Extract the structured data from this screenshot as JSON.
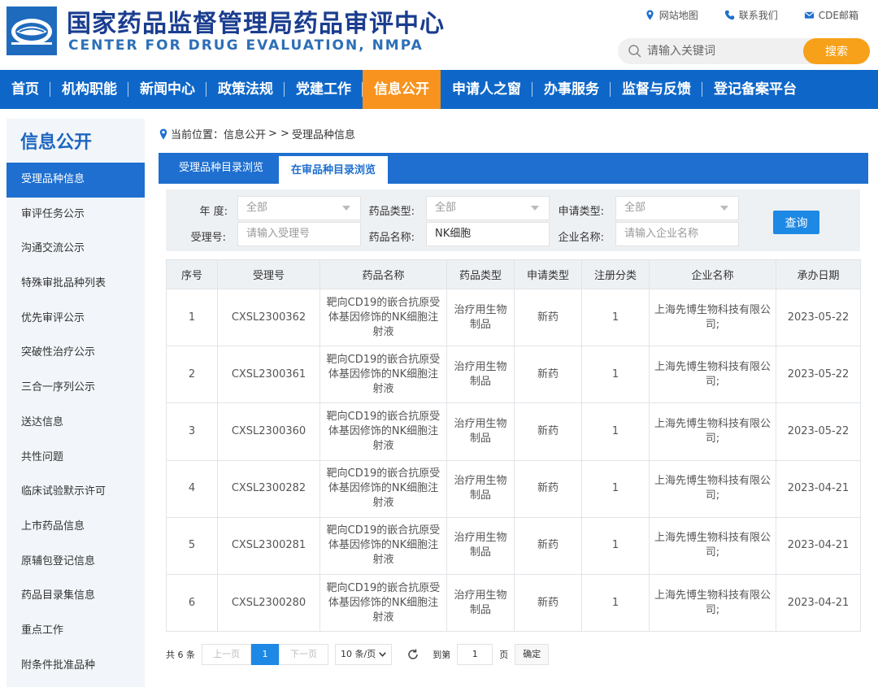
{
  "header": {
    "title_cn": "国家药品监督管理局药品审评中心",
    "title_en": "CENTER FOR DRUG EVALUATION, NMPA",
    "links": [
      {
        "label": "网站地图",
        "icon": "location-icon"
      },
      {
        "label": "联系我们",
        "icon": "phone-icon"
      },
      {
        "label": "CDE邮箱",
        "icon": "mail-icon"
      }
    ],
    "search_placeholder": "请输入关键词",
    "search_button": "搜索"
  },
  "nav": {
    "items": [
      "首页",
      "机构职能",
      "新闻中心",
      "政策法规",
      "党建工作",
      "信息公开",
      "申请人之窗",
      "办事服务",
      "监督与反馈",
      "登记备案平台"
    ],
    "active": "信息公开"
  },
  "sidebar": {
    "title": "信息公开",
    "items": [
      "受理品种信息",
      "审评任务公示",
      "沟通交流公示",
      "特殊审批品种列表",
      "优先审评公示",
      "突破性治疗公示",
      "三合一序列公示",
      "送达信息",
      "共性问题",
      "临床试验默示许可",
      "上市药品信息",
      "原辅包登记信息",
      "药品目录集信息",
      "重点工作",
      "附条件批准品种"
    ],
    "active": "受理品种信息"
  },
  "breadcrumb": {
    "prefix": "当前位置：信息公开",
    "separator": "> >",
    "current": "受理品种信息"
  },
  "tabs": {
    "items": [
      "受理品种目录浏览",
      "在审品种目录浏览"
    ],
    "active": "在审品种目录浏览"
  },
  "filters": {
    "year_label": "年    度:",
    "year_value": "全部",
    "drug_type_label": "药品类型:",
    "drug_type_value": "全部",
    "apply_type_label": "申请类型:",
    "apply_type_value": "全部",
    "accept_no_label": "受理号:",
    "accept_no_placeholder": "请输入受理号",
    "drug_name_label": "药品名称:",
    "drug_name_value": "NK细胞",
    "company_label": "企业名称:",
    "company_placeholder": "请输入企业名称",
    "query_button": "查询"
  },
  "table": {
    "columns": [
      "序号",
      "受理号",
      "药品名称",
      "药品类型",
      "申请类型",
      "注册分类",
      "企业名称",
      "承办日期"
    ],
    "rows": [
      {
        "no": "1",
        "accept_no": "CXSL2300362",
        "drug_name": "靶向CD19的嵌合抗原受体基因修饰的NK细胞注射液",
        "drug_type": "治疗用生物制品",
        "apply_type": "新药",
        "reg_class": "1",
        "company": "上海先博生物科技有限公司;",
        "date": "2023-05-22"
      },
      {
        "no": "2",
        "accept_no": "CXSL2300361",
        "drug_name": "靶向CD19的嵌合抗原受体基因修饰的NK细胞注射液",
        "drug_type": "治疗用生物制品",
        "apply_type": "新药",
        "reg_class": "1",
        "company": "上海先博生物科技有限公司;",
        "date": "2023-05-22"
      },
      {
        "no": "3",
        "accept_no": "CXSL2300360",
        "drug_name": "靶向CD19的嵌合抗原受体基因修饰的NK细胞注射液",
        "drug_type": "治疗用生物制品",
        "apply_type": "新药",
        "reg_class": "1",
        "company": "上海先博生物科技有限公司;",
        "date": "2023-05-22"
      },
      {
        "no": "4",
        "accept_no": "CXSL2300282",
        "drug_name": "靶向CD19的嵌合抗原受体基因修饰的NK细胞注射液",
        "drug_type": "治疗用生物制品",
        "apply_type": "新药",
        "reg_class": "1",
        "company": "上海先博生物科技有限公司;",
        "date": "2023-04-21"
      },
      {
        "no": "5",
        "accept_no": "CXSL2300281",
        "drug_name": "靶向CD19的嵌合抗原受体基因修饰的NK细胞注射液",
        "drug_type": "治疗用生物制品",
        "apply_type": "新药",
        "reg_class": "1",
        "company": "上海先博生物科技有限公司;",
        "date": "2023-04-21"
      },
      {
        "no": "6",
        "accept_no": "CXSL2300280",
        "drug_name": "靶向CD19的嵌合抗原受体基因修饰的NK细胞注射液",
        "drug_type": "治疗用生物制品",
        "apply_type": "新药",
        "reg_class": "1",
        "company": "上海先博生物科技有限公司;",
        "date": "2023-04-21"
      }
    ]
  },
  "pager": {
    "total": "共 6 条",
    "prev": "上一页",
    "current_page": "1",
    "next": "下一页",
    "page_size": "10 条/页",
    "goto_label": "到第",
    "goto_value": "1",
    "page_unit": "页",
    "confirm": "确定"
  },
  "colors": {
    "brand_blue": "#0e67c8",
    "active_orange": "#f7931e",
    "search_orange": "#f7a11a"
  }
}
